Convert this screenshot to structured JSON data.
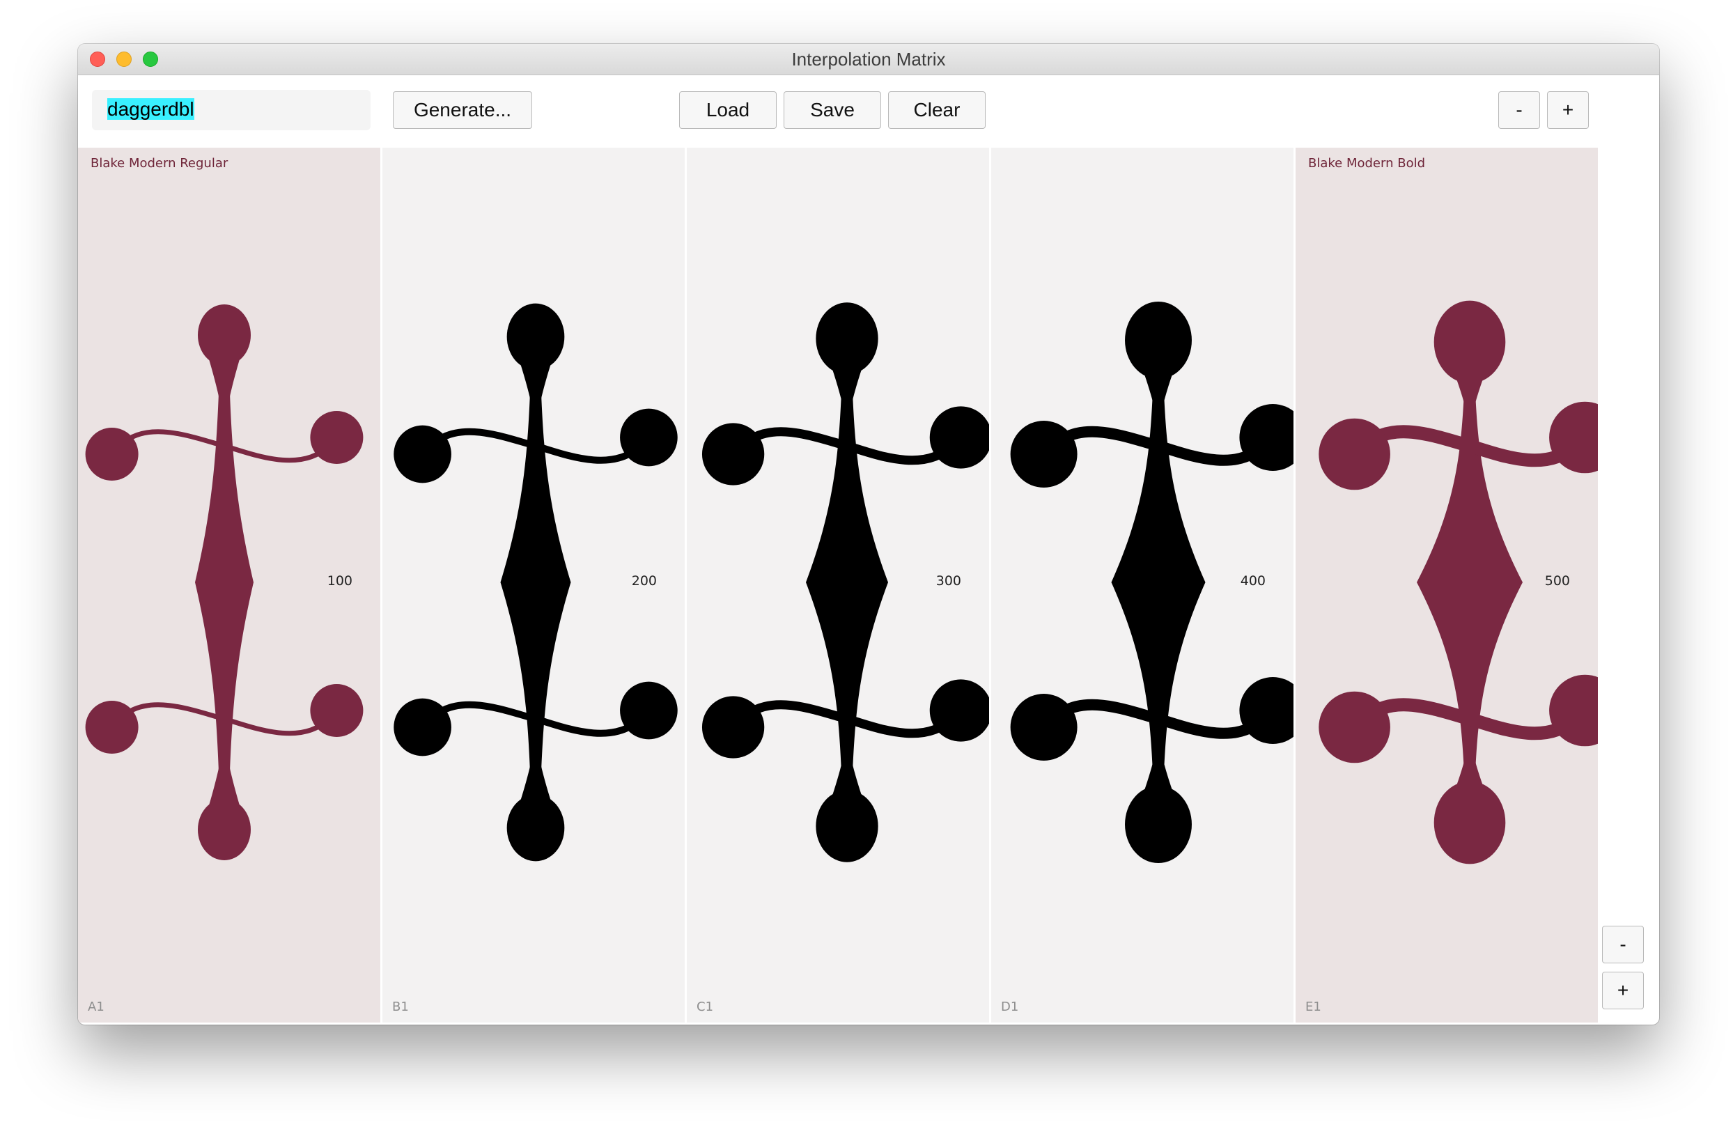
{
  "window": {
    "title": "Interpolation Matrix"
  },
  "toolbar": {
    "glyph_name": "daggerdbl",
    "generate_label": "Generate...",
    "load_label": "Load",
    "save_label": "Save",
    "clear_label": "Clear",
    "zoom_out_label": "-",
    "zoom_in_label": "+"
  },
  "side_controls": {
    "minus_label": "-",
    "plus_label": "+"
  },
  "cells": [
    {
      "id": "A1",
      "weight": "100",
      "master": true,
      "master_name": "Blake Modern Regular",
      "ink": 0.0
    },
    {
      "id": "B1",
      "weight": "200",
      "master": false,
      "master_name": "",
      "ink": 0.25
    },
    {
      "id": "C1",
      "weight": "300",
      "master": false,
      "master_name": "",
      "ink": 0.5
    },
    {
      "id": "D1",
      "weight": "400",
      "master": false,
      "master_name": "",
      "ink": 0.75
    },
    {
      "id": "E1",
      "weight": "500",
      "master": true,
      "master_name": "Blake Modern Bold",
      "ink": 1.0
    }
  ],
  "colors": {
    "master_glyph": "#7a2842",
    "instance_glyph": "#000000",
    "master_bg": "#ebe3e3",
    "instance_bg": "#f3f2f2",
    "selection": "#39f0ff"
  }
}
